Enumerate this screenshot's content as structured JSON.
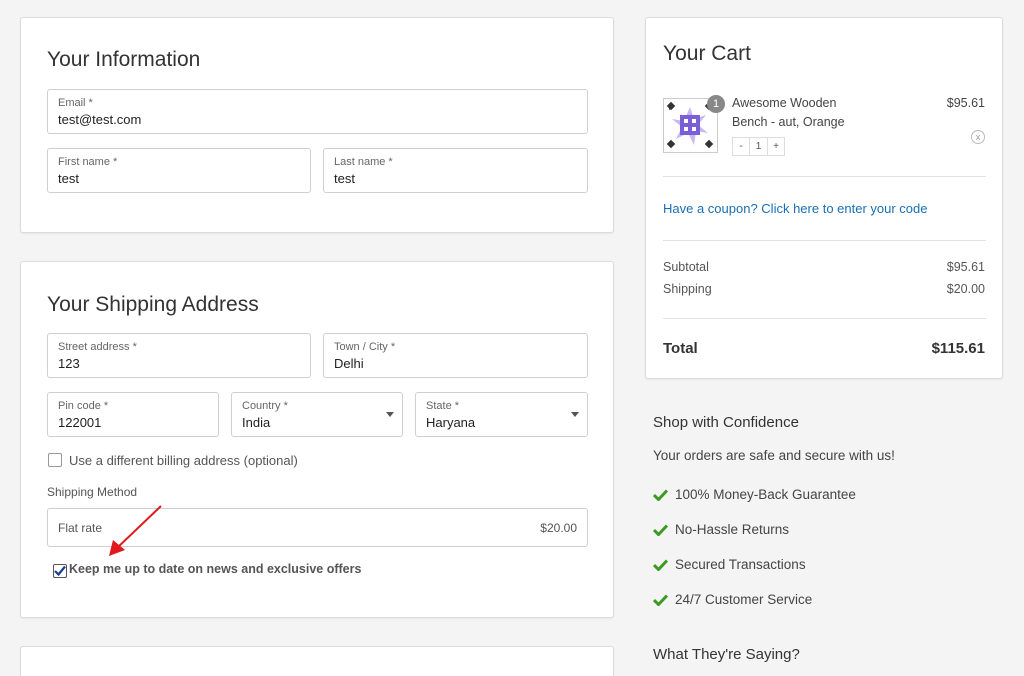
{
  "info": {
    "title": "Your Information",
    "email": {
      "label": "Email *",
      "value": "test@test.com"
    },
    "first_name": {
      "label": "First name *",
      "value": "test"
    },
    "last_name": {
      "label": "Last name *",
      "value": "test"
    }
  },
  "shipping": {
    "title": "Your Shipping Address",
    "street": {
      "label": "Street address *",
      "value": "123"
    },
    "city": {
      "label": "Town / City *",
      "value": "Delhi"
    },
    "pin": {
      "label": "Pin code *",
      "value": "122001"
    },
    "country": {
      "label": "Country *",
      "value": "India"
    },
    "state": {
      "label": "State *",
      "value": "Haryana"
    },
    "billing_label": "Use a different billing address (optional)",
    "method_title": "Shipping Method",
    "method_name": "Flat rate",
    "method_price": "$20.00",
    "news_label": "Keep me up to date on news and exclusive offers"
  },
  "cart": {
    "title": "Your Cart",
    "item": {
      "qty_badge": "1",
      "name_line1": "Awesome Wooden",
      "name_line2": "Bench - aut, Orange",
      "price": "$95.61",
      "minus": "-",
      "qty": "1",
      "plus": "+",
      "remove": "x"
    },
    "coupon": "Have a coupon? Click here to enter your code",
    "subtotal_label": "Subtotal",
    "subtotal_value": "$95.61",
    "shipping_label": "Shipping",
    "shipping_value": "$20.00",
    "total_label": "Total",
    "total_value": "$115.61"
  },
  "confidence": {
    "title": "Shop with Confidence",
    "subtitle": "Your orders are safe and secure with us!",
    "items": [
      "100% Money-Back Guarantee",
      "No-Hassle Returns",
      "Secured Transactions",
      "24/7 Customer Service"
    ],
    "check_color": "#3a9b22"
  },
  "testimonials_title": "What They're Saying?",
  "colors": {
    "link": "#1a6fb4",
    "annotation_arrow": "#e01a1a"
  }
}
